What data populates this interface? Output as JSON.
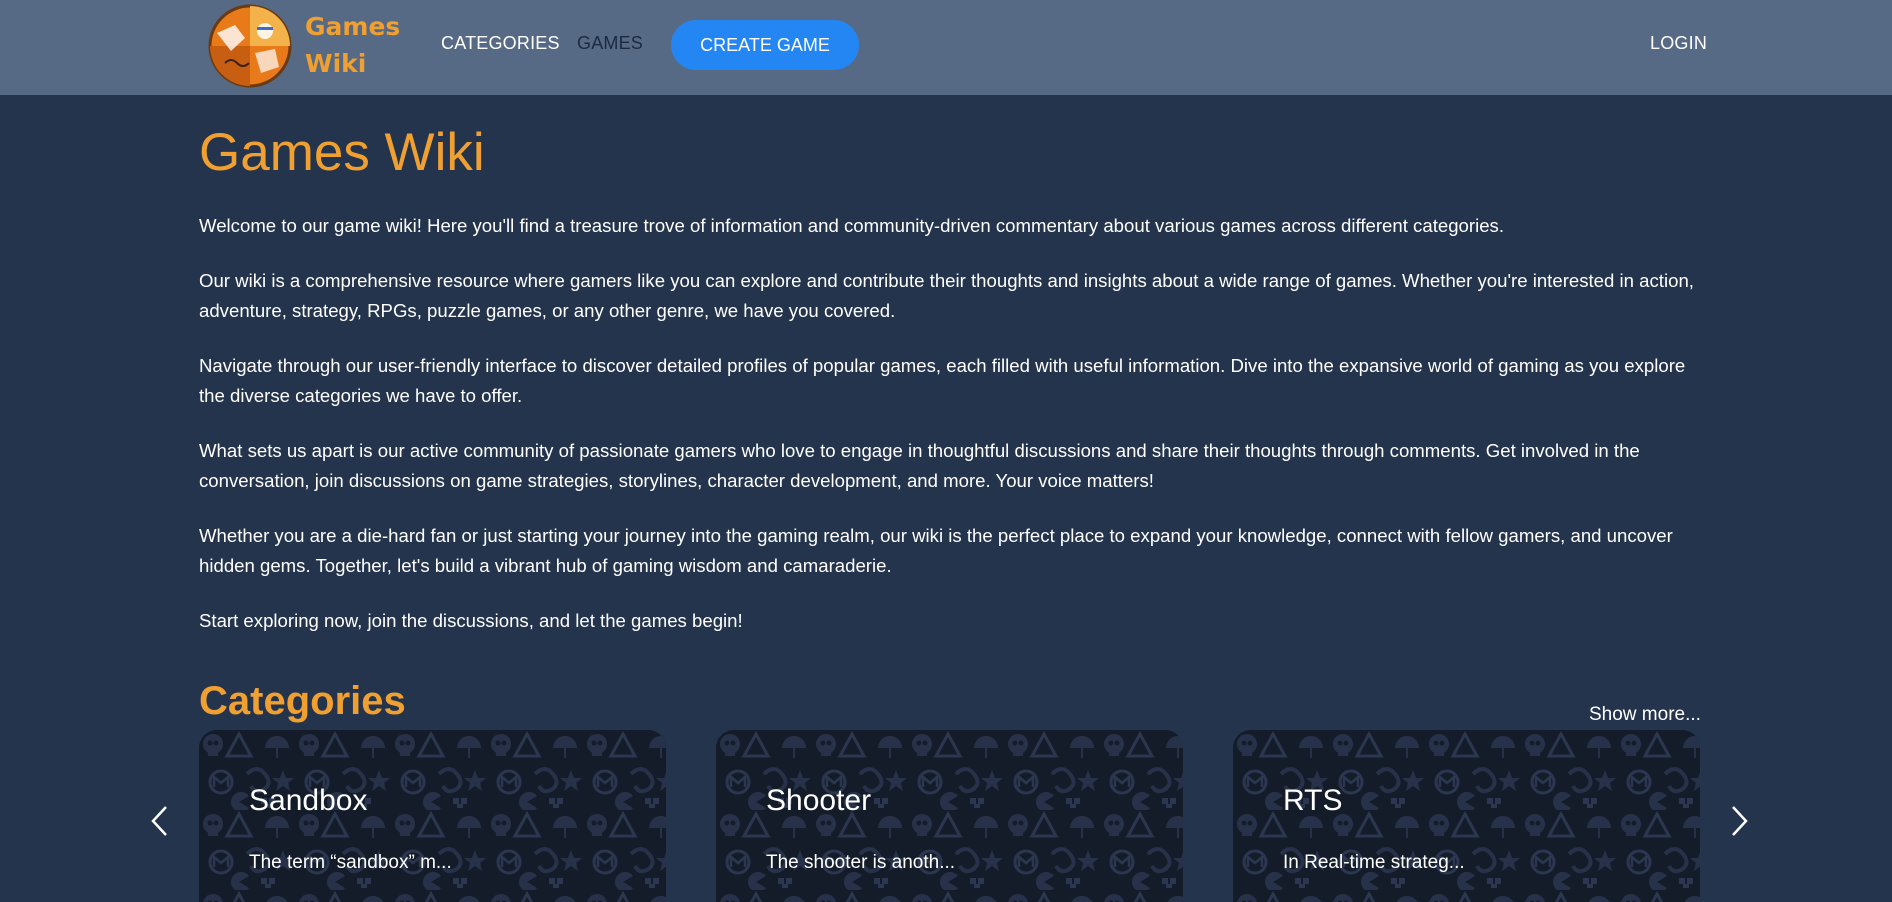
{
  "header": {
    "brand_line1": "Games",
    "brand_line2": "Wiki",
    "nav": {
      "categories": "CATEGORIES",
      "games": "GAMES",
      "create_game": "CREATE GAME",
      "login": "LOGIN"
    }
  },
  "main": {
    "title": "Games Wiki",
    "paragraphs": [
      "Welcome to our game wiki! Here you'll find a treasure trove of information and community-driven commentary about various games across different categories.",
      "Our wiki is a comprehensive resource where gamers like you can explore and contribute their thoughts and insights about a wide range of games. Whether you're interested in action, adventure, strategy, RPGs, puzzle games, or any other genre, we have you covered.",
      "Navigate through our user-friendly interface to discover detailed profiles of popular games, each filled with useful information. Dive into the expansive world of gaming as you explore the diverse categories we have to offer.",
      "What sets us apart is our active community of passionate gamers who love to engage in thoughtful discussions and share their thoughts through comments. Get involved in the conversation, join discussions on game strategies, storylines, character development, and more. Your voice matters!",
      "Whether you are a die-hard fan or just starting your journey into the gaming realm, our wiki is the perfect place to expand your knowledge, connect with fellow gamers, and uncover hidden gems. Together, let's build a vibrant hub of gaming wisdom and camaraderie.",
      "Start exploring now, join the discussions, and let the games begin!"
    ]
  },
  "categories": {
    "title": "Categories",
    "show_more": "Show more...",
    "cards": [
      {
        "title": "Sandbox",
        "description": "The term “sandbox” m..."
      },
      {
        "title": "Shooter",
        "description": "The shooter is anoth..."
      },
      {
        "title": "RTS",
        "description": "In Real-time strateg..."
      }
    ]
  },
  "colors": {
    "background": "#24344d",
    "header": "#576a85",
    "accent": "#f0a030",
    "button": "#2486f3"
  },
  "icons": [
    "games-wiki-logo",
    "chevron-left-icon",
    "chevron-right-icon"
  ]
}
